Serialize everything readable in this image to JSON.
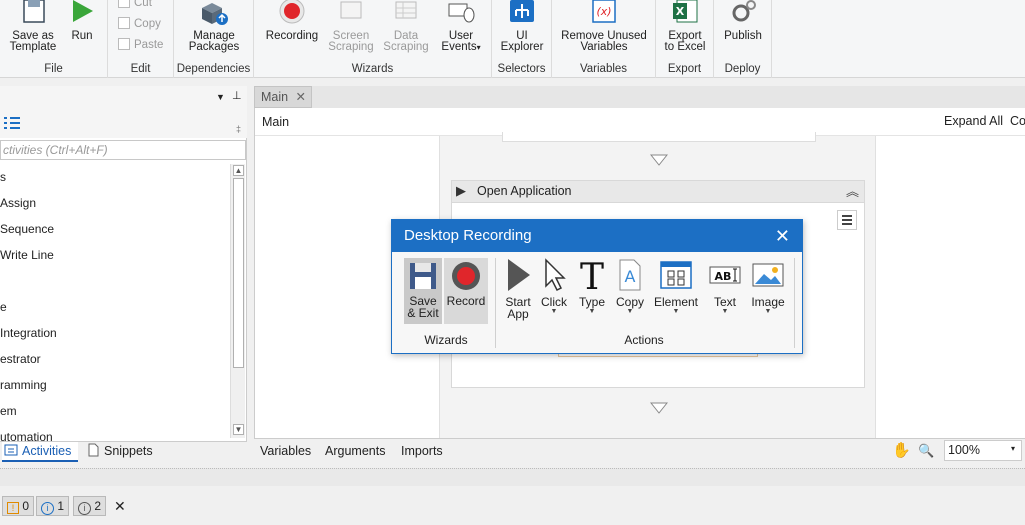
{
  "ribbon": {
    "save_template": "Save as\nTemplate",
    "run": "Run",
    "cut": "Cut",
    "copy": "Copy",
    "paste": "Paste",
    "manage_packages": "Manage\nPackages",
    "recording": "Recording",
    "screen_scraping": "Screen\nScraping",
    "data_scraping": "Data\nScraping",
    "user_events": "User\nEvents",
    "ui_explorer": "UI\nExplorer",
    "remove_unused_vars": "Remove Unused\nVariables",
    "export_excel": "Export\nto Excel",
    "publish": "Publish",
    "groups": {
      "file": "File",
      "edit": "Edit",
      "dependencies": "Dependencies",
      "wizards": "Wizards",
      "selectors": "Selectors",
      "variables": "Variables",
      "export": "Export",
      "deploy": "Deploy"
    }
  },
  "left_panel": {
    "search_placeholder": "ctivities (Ctrl+Alt+F)",
    "items": [
      "s",
      "Assign",
      "Sequence",
      "Write Line",
      "",
      "e",
      "Integration",
      "estrator",
      "ramming",
      "em",
      "utomation"
    ],
    "tabs": {
      "activities": "Activities",
      "snippets": "Snippets"
    }
  },
  "document": {
    "tab": "Main",
    "breadcrumb": "Main",
    "expand_all": "Expand All",
    "collapse_partial": "Col",
    "open_application": "Open Application"
  },
  "bottom_bar": {
    "variables": "Variables",
    "arguments": "Arguments",
    "imports": "Imports",
    "zoom": "100%"
  },
  "output": {
    "warnings": "0",
    "info1": "1",
    "info2": "2"
  },
  "dialog": {
    "title": "Desktop Recording",
    "save_exit": "Save\n& Exit",
    "record": "Record",
    "start_app": "Start\nApp",
    "click": "Click",
    "type": "Type",
    "copy": "Copy",
    "element": "Element",
    "text": "Text",
    "image": "Image",
    "group_wizards": "Wizards",
    "group_actions": "Actions"
  },
  "colors": {
    "accent": "#1c6fc4",
    "record_red": "#e0262b",
    "run_green": "#3aa63a"
  }
}
